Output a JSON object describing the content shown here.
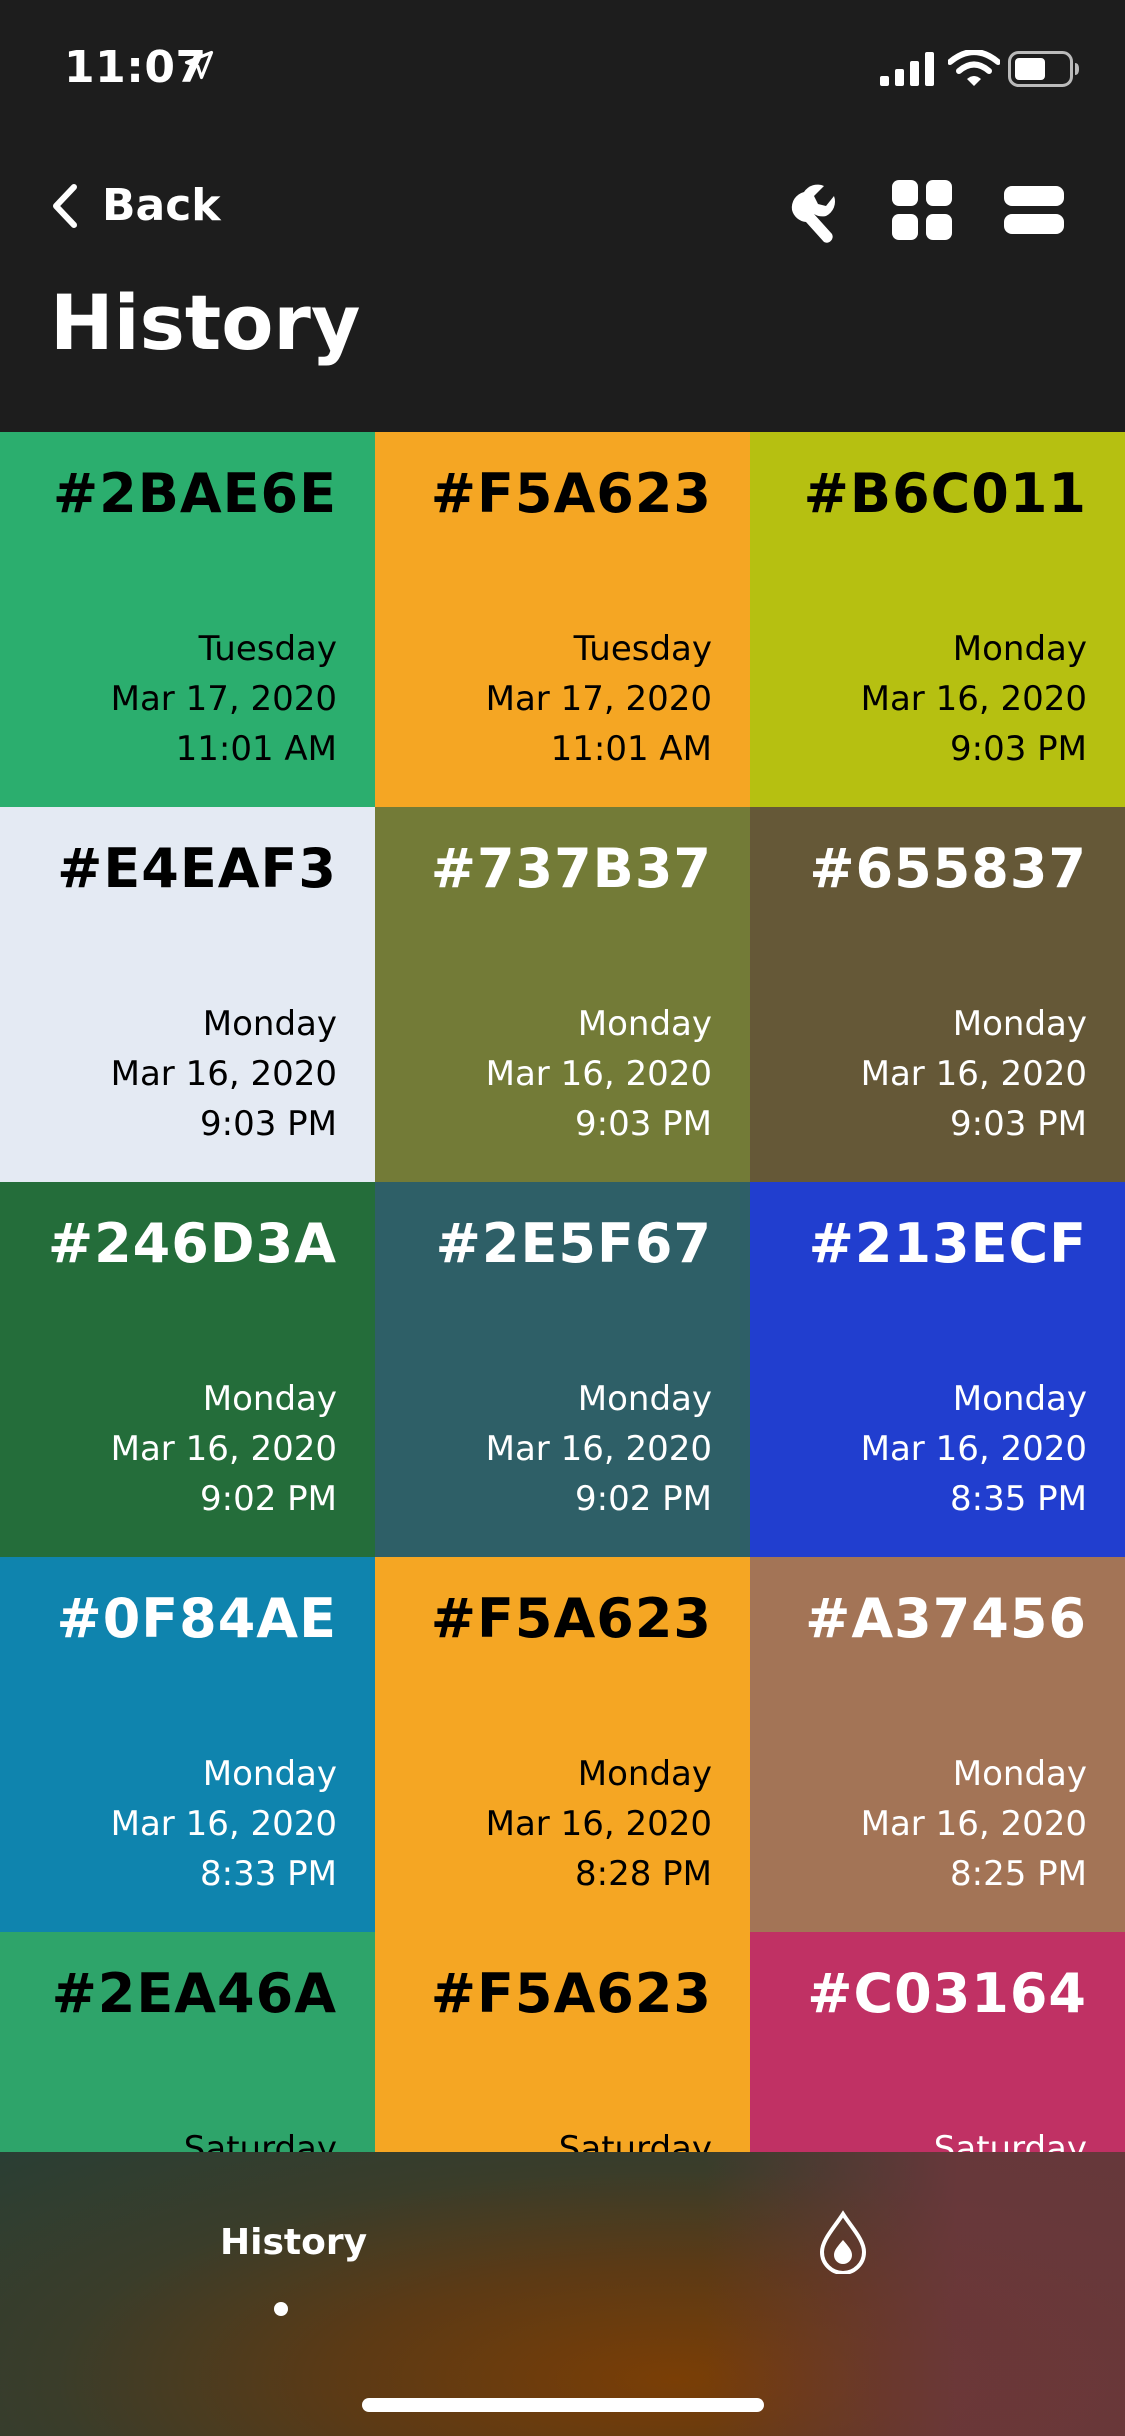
{
  "status_bar": {
    "time": "11:07"
  },
  "header": {
    "back_label": "Back",
    "title": "History"
  },
  "swatches": [
    {
      "hex": "#2BAE6E",
      "day": "Tuesday",
      "date": "Mar 17, 2020",
      "time": "11:01 AM",
      "bg": "#2BAE6E",
      "fg": "#000000"
    },
    {
      "hex": "#F5A623",
      "day": "Tuesday",
      "date": "Mar 17, 2020",
      "time": "11:01 AM",
      "bg": "#F5A623",
      "fg": "#000000"
    },
    {
      "hex": "#B6C011",
      "day": "Monday",
      "date": "Mar 16, 2020",
      "time": "9:03 PM",
      "bg": "#B6C011",
      "fg": "#000000"
    },
    {
      "hex": "#E4EAF3",
      "day": "Monday",
      "date": "Mar 16, 2020",
      "time": "9:03 PM",
      "bg": "#E4EAF3",
      "fg": "#000000"
    },
    {
      "hex": "#737B37",
      "day": "Monday",
      "date": "Mar 16, 2020",
      "time": "9:03 PM",
      "bg": "#737B37",
      "fg": "#FFFFFF"
    },
    {
      "hex": "#655837",
      "day": "Monday",
      "date": "Mar 16, 2020",
      "time": "9:03 PM",
      "bg": "#655837",
      "fg": "#FFFFFF"
    },
    {
      "hex": "#246D3A",
      "day": "Monday",
      "date": "Mar 16, 2020",
      "time": "9:02 PM",
      "bg": "#246D3A",
      "fg": "#FFFFFF"
    },
    {
      "hex": "#2E5F67",
      "day": "Monday",
      "date": "Mar 16, 2020",
      "time": "9:02 PM",
      "bg": "#2E5F67",
      "fg": "#FFFFFF"
    },
    {
      "hex": "#213ECF",
      "day": "Monday",
      "date": "Mar 16, 2020",
      "time": "8:35 PM",
      "bg": "#213ECF",
      "fg": "#FFFFFF"
    },
    {
      "hex": "#0F84AE",
      "day": "Monday",
      "date": "Mar 16, 2020",
      "time": "8:33 PM",
      "bg": "#0F84AE",
      "fg": "#FFFFFF"
    },
    {
      "hex": "#F5A623",
      "day": "Monday",
      "date": "Mar 16, 2020",
      "time": "8:28 PM",
      "bg": "#F5A623",
      "fg": "#000000"
    },
    {
      "hex": "#A37456",
      "day": "Monday",
      "date": "Mar 16, 2020",
      "time": "8:25 PM",
      "bg": "#A37456",
      "fg": "#FFFFFF"
    },
    {
      "hex": "#2EA46A",
      "day": "Saturday",
      "date": "",
      "time": "",
      "bg": "#2EA46A",
      "fg": "#000000"
    },
    {
      "hex": "#F5A623",
      "day": "Saturday",
      "date": "",
      "time": "",
      "bg": "#F5A623",
      "fg": "#000000"
    },
    {
      "hex": "#C03164",
      "day": "Saturday",
      "date": "",
      "time": "",
      "bg": "#C03164",
      "fg": "#FFFFFF"
    }
  ],
  "tab_bar": {
    "history_label": "History"
  },
  "icons": {
    "location": "location-arrow-icon",
    "signal": "cellular-signal-icon",
    "wifi": "wifi-icon",
    "battery": "battery-icon",
    "back": "chevron-left-icon",
    "tool": "wrench-icon",
    "grid": "grid-view-icon",
    "list": "list-view-icon",
    "drop": "color-drop-icon"
  }
}
